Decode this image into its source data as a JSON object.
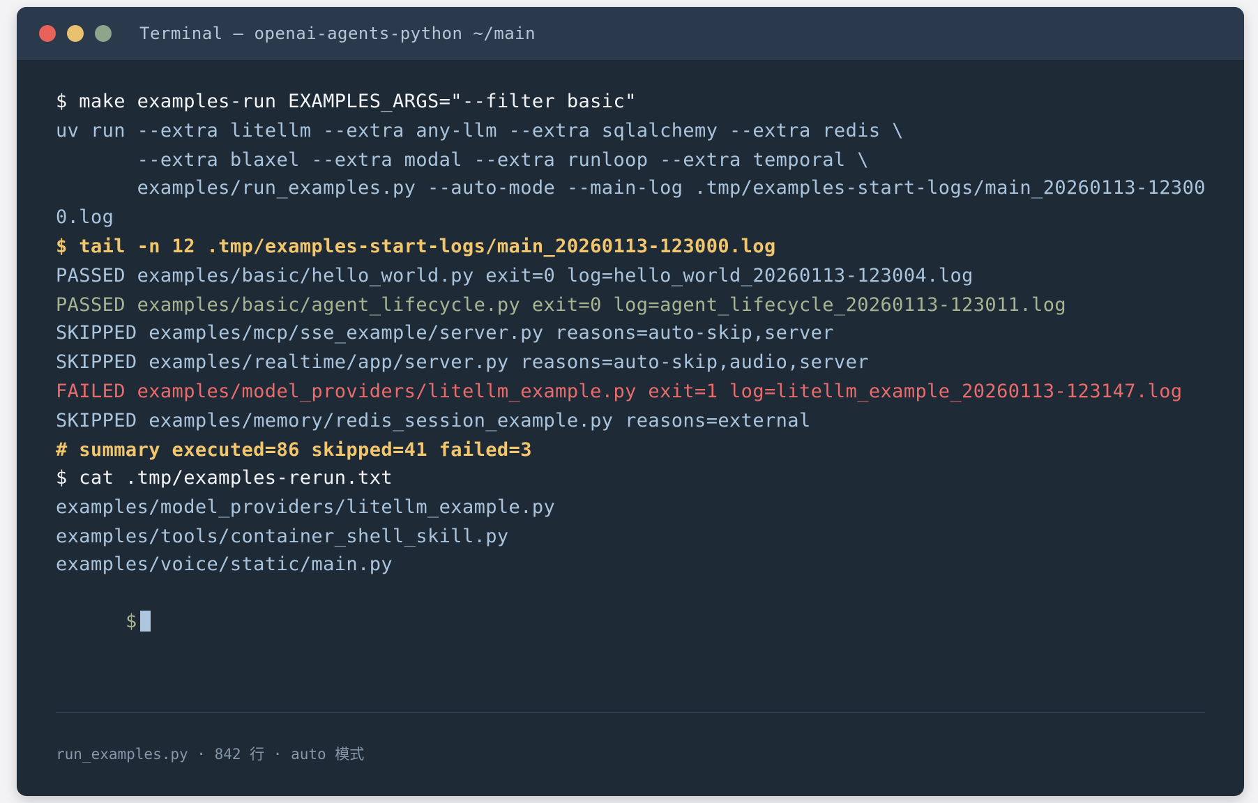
{
  "window": {
    "title": "Terminal — openai-agents-python ~/main"
  },
  "terminal": {
    "lines": [
      {
        "text": "$ make examples-run EXAMPLES_ARGS=\"--filter basic\"",
        "style": "cmd-white"
      },
      {
        "text": "uv run --extra litellm --extra any-llm --extra sqlalchemy --extra redis \\",
        "style": "plain"
      },
      {
        "text": "       --extra blaxel --extra modal --extra runloop --extra temporal \\",
        "style": "plain"
      },
      {
        "text": "       examples/run_examples.py --auto-mode --main-log .tmp/examples-start-logs/main_20260113-12300",
        "style": "plain"
      },
      {
        "text": "0.log",
        "style": "plain"
      },
      {
        "text": "$ tail -n 12 .tmp/examples-start-logs/main_20260113-123000.log",
        "style": "cmd-yellow"
      },
      {
        "text": "PASSED examples/basic/hello_world.py exit=0 log=hello_world_20260113-123004.log",
        "style": "plain"
      },
      {
        "text": "PASSED examples/basic/agent_lifecycle.py exit=0 log=agent_lifecycle_20260113-123011.log",
        "style": "passed-muted"
      },
      {
        "text": "SKIPPED examples/mcp/sse_example/server.py reasons=auto-skip,server",
        "style": "plain"
      },
      {
        "text": "SKIPPED examples/realtime/app/server.py reasons=auto-skip,audio,server",
        "style": "plain"
      },
      {
        "text": "FAILED examples/model_providers/litellm_example.py exit=1 log=litellm_example_20260113-123147.log",
        "style": "failed"
      },
      {
        "text": "SKIPPED examples/memory/redis_session_example.py reasons=external",
        "style": "plain"
      },
      {
        "text": "# summary executed=86 skipped=41 failed=3",
        "style": "cmd-yellow"
      },
      {
        "text": "$ cat .tmp/examples-rerun.txt",
        "style": "cmd-white"
      },
      {
        "text": "examples/model_providers/litellm_example.py",
        "style": "plain"
      },
      {
        "text": "examples/tools/container_shell_skill.py",
        "style": "plain"
      },
      {
        "text": "examples/voice/static/main.py",
        "style": "plain"
      }
    ],
    "prompt": "$"
  },
  "status_bar": {
    "text": "run_examples.py · 842 行 · auto 模式"
  },
  "colors": {
    "background": "#1e2a36",
    "titlebar": "#2a3a4c",
    "plain": "#a9c4dc",
    "highlight_yellow": "#f2c66d",
    "failed_red": "#ea6b6b",
    "muted_green": "#a7b492"
  }
}
